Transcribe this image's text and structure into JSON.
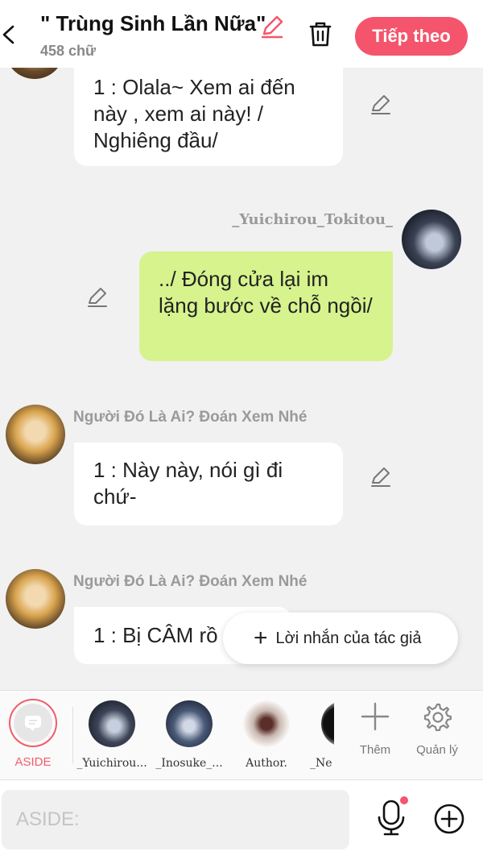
{
  "header": {
    "title": "\" Trùng Sinh Lần Nữa\"",
    "word_count": "458 chữ",
    "next_label": "Tiếp theo",
    "accent_color": "#f4556c"
  },
  "messages": [
    {
      "side": "left",
      "author": "",
      "text": "1 : Olala~ Xem ai đến này , xem ai này! / Nghiêng đầu/",
      "bubble_color": "#ffffff"
    },
    {
      "side": "right",
      "author": "_Yuichirou_Tokitou_",
      "text": "../ Đóng cửa lại im lặng bước về chỗ ngồi/",
      "bubble_color": "#d6f38d"
    },
    {
      "side": "left",
      "author": "Người Đó Là Ai? Đoán Xem Nhé",
      "text": "1 : Này này, nói gì đi chứ-",
      "bubble_color": "#ffffff"
    },
    {
      "side": "left",
      "author": "Người Đó Là Ai? Đoán Xem Nhé",
      "text": "1 : Bị CÂM rồ",
      "bubble_color": "#ffffff"
    }
  ],
  "author_note": {
    "label": "Lời nhắn của tác giả",
    "icon": "plus-icon"
  },
  "characters": {
    "aside_label": "ASIDE",
    "items": [
      {
        "name": "_Yuichirou..."
      },
      {
        "name": "_Inosuke_..."
      },
      {
        "name": "Author."
      },
      {
        "name": "_Ne"
      }
    ],
    "add_label": "Thêm",
    "manage_label": "Quản lý"
  },
  "input": {
    "placeholder": "ASIDE:",
    "value": ""
  },
  "icons": [
    "back-icon",
    "pencil-icon",
    "trash-icon",
    "mic-icon",
    "add-circle-icon",
    "gear-icon",
    "plus-icon"
  ]
}
